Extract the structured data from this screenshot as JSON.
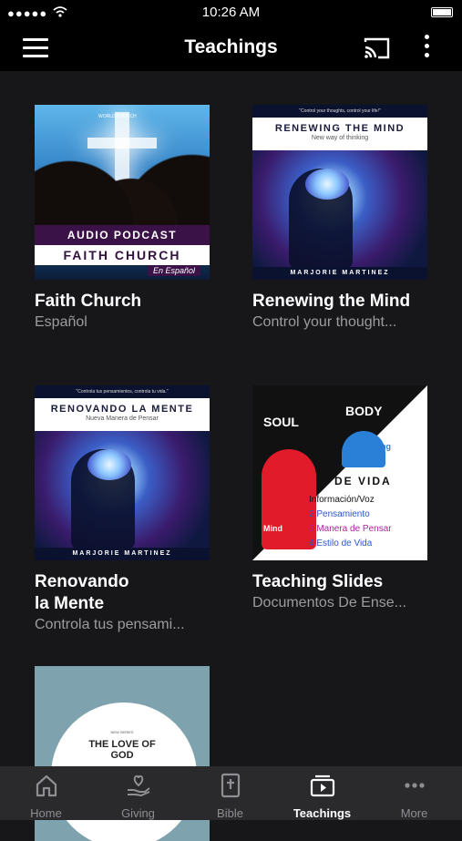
{
  "status_bar": {
    "signal": "●●●●●",
    "time": "10:26 AM"
  },
  "header": {
    "title": "Teachings"
  },
  "cards": [
    {
      "title": "Faith Church",
      "subtitle": "Español",
      "cover": {
        "podcast": "AUDIO PODCAST",
        "name": "FAITH CHURCH",
        "lang": "En Español",
        "logo": "WORLD CHURCH"
      }
    },
    {
      "title": "Renewing the Mind",
      "subtitle": "Control your thought...",
      "cover": {
        "quote": "\"Control your thoughts, control your life!\"",
        "heading": "RENEWING THE MIND",
        "tagline": "New way of thinking",
        "author": "MARJORIE MARTINEZ"
      }
    },
    {
      "title_line1": "Renovando",
      "title_line2": "la Mente",
      "subtitle": "Controla tus pensami...",
      "cover": {
        "quote": "\"Controla tus pensamientos, controla tu vida.\"",
        "heading": "RENOVANDO LA MENTE",
        "tagline": "Nueva Manera de Pensar",
        "author": "MARJORIE MARTINEZ"
      }
    },
    {
      "title": "Teaching Slides",
      "subtitle": "Documentos De Ense...",
      "cover": {
        "soul": "SOUL",
        "body": "BODY",
        "vida": "D DE VIDA",
        "items": [
          "Información/Voz",
          "2 Pensamiento",
          "3 Manera de Pensar",
          "4 Estilo de Vida"
        ],
        "mind": "Mind",
        "thinking": "hinking"
      }
    },
    {
      "title": "",
      "subtitle": "",
      "cover": {
        "series": "NEW SERIES",
        "line1": "THE LOVE OF",
        "line2": "GOD"
      }
    }
  ],
  "tabs": [
    {
      "label": "Home",
      "icon": "home-icon"
    },
    {
      "label": "Giving",
      "icon": "giving-icon"
    },
    {
      "label": "Bible",
      "icon": "bible-icon"
    },
    {
      "label": "Teachings",
      "icon": "teachings-icon",
      "active": true
    },
    {
      "label": "More",
      "icon": "more-icon"
    }
  ],
  "colors": {
    "background": "#17171a",
    "bar": "#000000",
    "tabbar": "#2a2a2d",
    "inactive": "#8e8e93",
    "subtitle": "#9c9c9f"
  }
}
